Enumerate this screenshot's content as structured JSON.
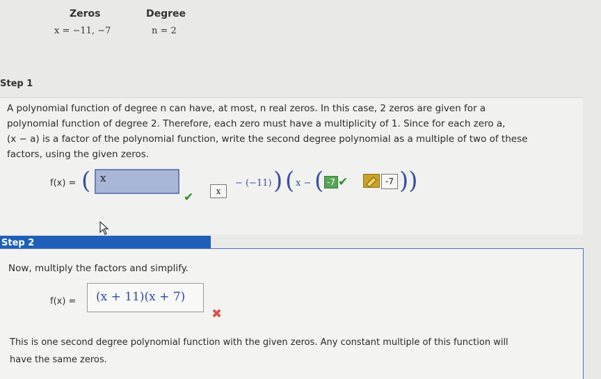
{
  "header": {
    "zeros_label": "Zeros",
    "zeros_value": "x = −11, −7",
    "degree_label": "Degree",
    "degree_value": "n = 2"
  },
  "step1": {
    "label": "Step 1",
    "paragraph_lines": [
      "A polynomial function of degree n can have, at most, n real zeros. In this case, 2 zeros are given for a",
      "polynomial function of degree 2. Therefore, each zero must have a multiplicity of 1. Since for each zero a,",
      "(x − a) is a factor of the polynomial function, write the second degree polynomial as a multiple of two of these",
      "factors, using the given zeros."
    ],
    "fx_label": "f(x) =",
    "input_value": "x",
    "small_box_value": "x",
    "minus_neg11": "− (−11)",
    "x_minus": "x −",
    "green_box_value": "-7",
    "tooltip_value": "-7"
  },
  "step2": {
    "label": "Step 2",
    "instruction": "Now, multiply the factors and simplify.",
    "fx_label": "f(x) =",
    "answer": "(x + 11)(x + 7)",
    "footer_lines": [
      "This is one second degree polynomial function with the given zeros. Any constant multiple of this function will",
      "have the same zeros."
    ]
  }
}
